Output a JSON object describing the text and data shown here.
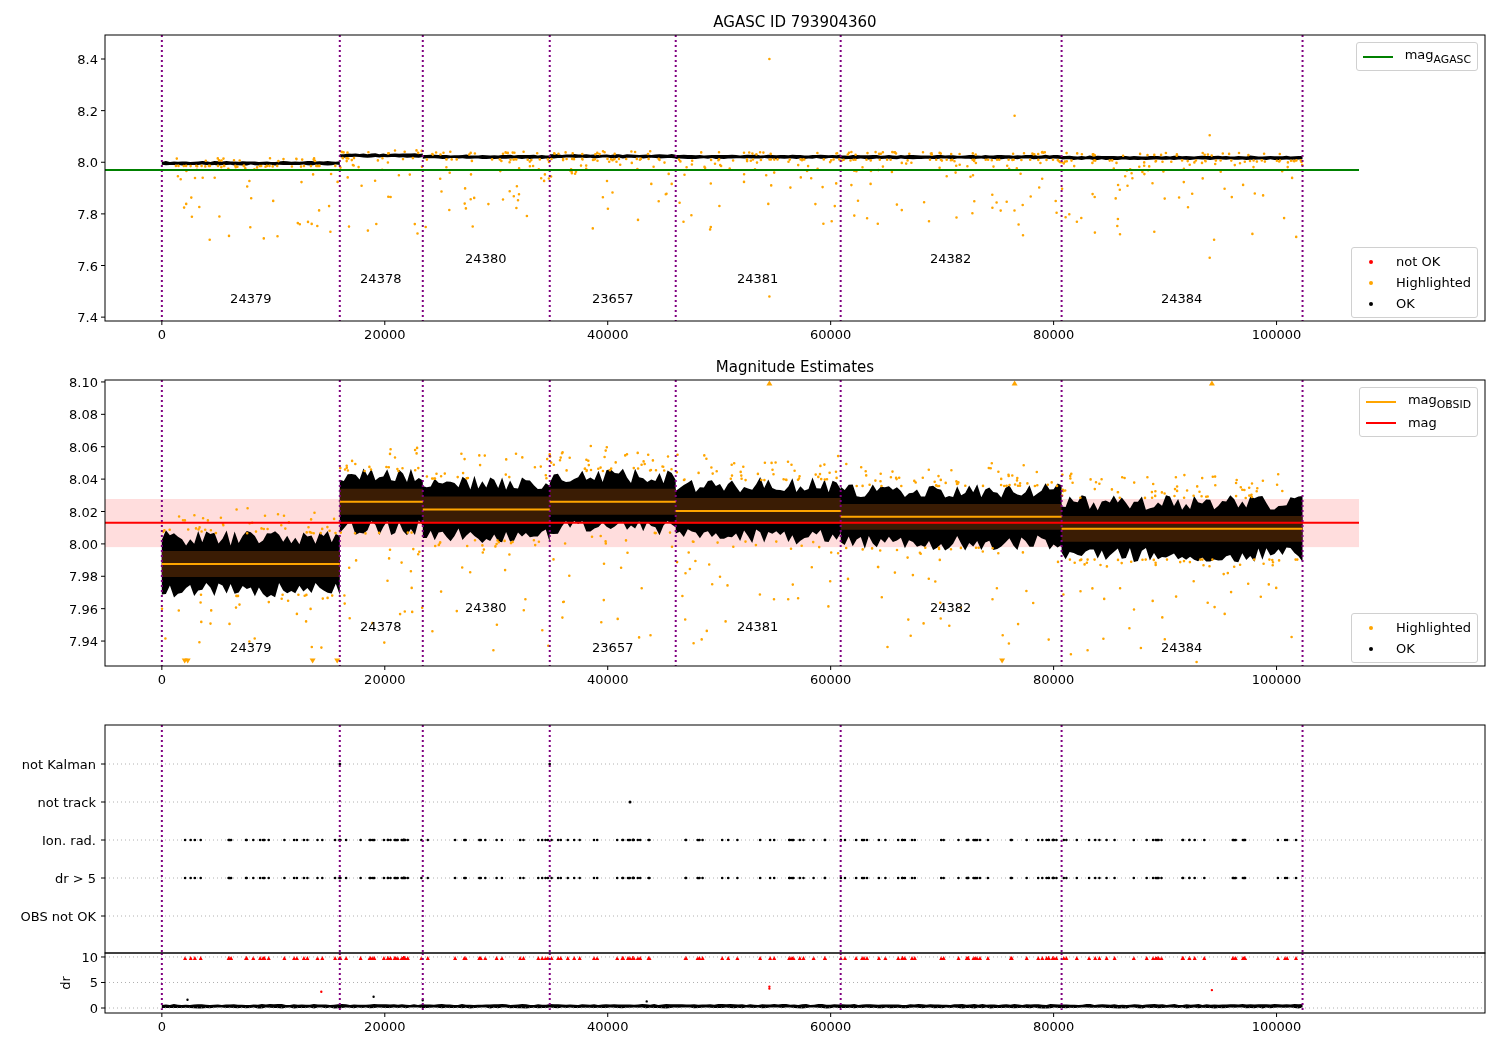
{
  "panels": [
    {
      "chart_data": {
        "type": "line",
        "title": "AGASC ID 793904360",
        "x": [
          -5100,
          107400
        ],
        "xlim": [
          -5100,
          118700
        ],
        "ylim": [
          7.385,
          8.493
        ],
        "xticks": [
          0,
          20000,
          40000,
          60000,
          80000,
          100000
        ],
        "yticks": [
          {
            "value": 7.4,
            "label": "7.4"
          },
          {
            "value": 7.6,
            "label": "7.6"
          },
          {
            "value": 7.8,
            "label": "7.8"
          },
          {
            "value": 8.0,
            "label": "8.0"
          },
          {
            "value": 8.2,
            "label": "8.2"
          },
          {
            "value": 8.4,
            "label": "8.4"
          }
        ],
        "series": [
          {
            "name": "mag$_{AGASC}$",
            "color": "#008000",
            "values": [
              7.97,
              7.97
            ]
          }
        ],
        "annotations": [
          {
            "text": "24379"
          },
          {
            "text": "24378"
          },
          {
            "text": "24380"
          },
          {
            "text": "23657"
          },
          {
            "text": "24381"
          },
          {
            "text": "24382"
          },
          {
            "text": "24384"
          }
        ]
      },
      "point_legend": [
        {
          "label": "not OK",
          "color": "#ff0000"
        },
        {
          "label": "Highlighted",
          "color": "#ffa500"
        },
        {
          "label": "OK",
          "color": "#000000"
        }
      ]
    },
    {
      "chart_data": {
        "type": "line",
        "title": "Magnitude Estimates",
        "x": [
          -5100,
          0,
          15964,
          15964,
          23408,
          23408,
          34798,
          34798,
          46099,
          46099,
          60897,
          60897,
          80717,
          80717,
          102332,
          107400
        ],
        "xlim": [
          -5100,
          118700
        ],
        "ylim": [
          7.9246,
          8.1012
        ],
        "xticks": [
          0,
          20000,
          40000,
          60000,
          80000,
          100000
        ],
        "yticks": [
          {
            "value": 7.94,
            "label": "7.94"
          },
          {
            "value": 7.96,
            "label": "7.96"
          },
          {
            "value": 7.98,
            "label": "7.98"
          },
          {
            "value": 8.0,
            "label": "8.00"
          },
          {
            "value": 8.02,
            "label": "8.02"
          },
          {
            "value": 8.04,
            "label": "8.04"
          },
          {
            "value": 8.06,
            "label": "8.06"
          },
          {
            "value": 8.08,
            "label": "8.08"
          },
          {
            "value": 8.1,
            "label": "8.10"
          }
        ],
        "series": [
          {
            "name": "mag$_{OBSID}$",
            "color": "#ffa500",
            "values": [
              null,
              7.9876,
              7.9876,
              8.026,
              8.026,
              8.0213,
              8.0213,
              8.026,
              8.026,
              8.0204,
              8.0204,
              8.0167,
              8.0167,
              8.0093,
              8.0093,
              null
            ]
          },
          {
            "name": "mag",
            "color": "#ff0000",
            "values": [
              8.013,
              8.013,
              8.013,
              8.013,
              8.013,
              8.013,
              8.013,
              8.013,
              8.013,
              8.013,
              8.013,
              8.013,
              8.013,
              8.013,
              8.013,
              8.013
            ]
          }
        ],
        "annotations": [
          {
            "text": "24379"
          },
          {
            "text": "24378"
          },
          {
            "text": "24380"
          },
          {
            "text": "23657"
          },
          {
            "text": "24381"
          },
          {
            "text": "24382"
          },
          {
            "text": "24384"
          }
        ]
      },
      "point_legend": [
        {
          "label": "Highlighted",
          "color": "#ffa500"
        },
        {
          "label": "OK",
          "color": "#000000"
        }
      ]
    },
    {
      "flag_rows": [
        "not Kalman",
        "not track",
        "Ion. rad.",
        "dr > 5",
        "OBS not OK"
      ],
      "chart_data": {
        "type": "scatter",
        "grid": true,
        "ylabel": "dr",
        "xlim": [
          -5100,
          118700
        ],
        "ylim": [
          -0.98,
          10.78
        ],
        "xticks": [
          0,
          20000,
          40000,
          60000,
          80000,
          100000
        ],
        "yticks": [
          {
            "value": 0,
            "label": "0"
          },
          {
            "value": 5,
            "label": "5"
          },
          {
            "value": 10,
            "label": "10"
          }
        ]
      }
    }
  ]
}
